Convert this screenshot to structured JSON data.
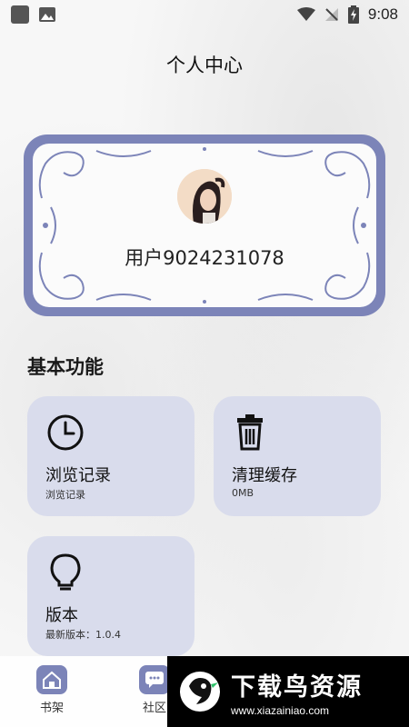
{
  "status_bar": {
    "time": "9:08"
  },
  "page_title": "个人中心",
  "profile": {
    "username": "用户9024231078"
  },
  "section_title": "基本功能",
  "cards": [
    {
      "title": "浏览记录",
      "subtitle": "浏览记录",
      "icon": "clock-icon"
    },
    {
      "title": "清理缓存",
      "subtitle": "0MB",
      "icon": "trash-icon"
    },
    {
      "title": "版本",
      "subtitle": "最新版本：1.0.4",
      "icon": "lightbulb-icon"
    }
  ],
  "bottom_nav": [
    {
      "label": "书架",
      "icon": "home-icon"
    },
    {
      "label": "社区",
      "icon": "chat-icon"
    }
  ],
  "watermark": {
    "text": "下载鸟资源",
    "url": "www.xiazainiao.com"
  },
  "colors": {
    "accent": "#7c84b8",
    "card_bg": "#d9dcec",
    "background": "#f7f7f7"
  }
}
